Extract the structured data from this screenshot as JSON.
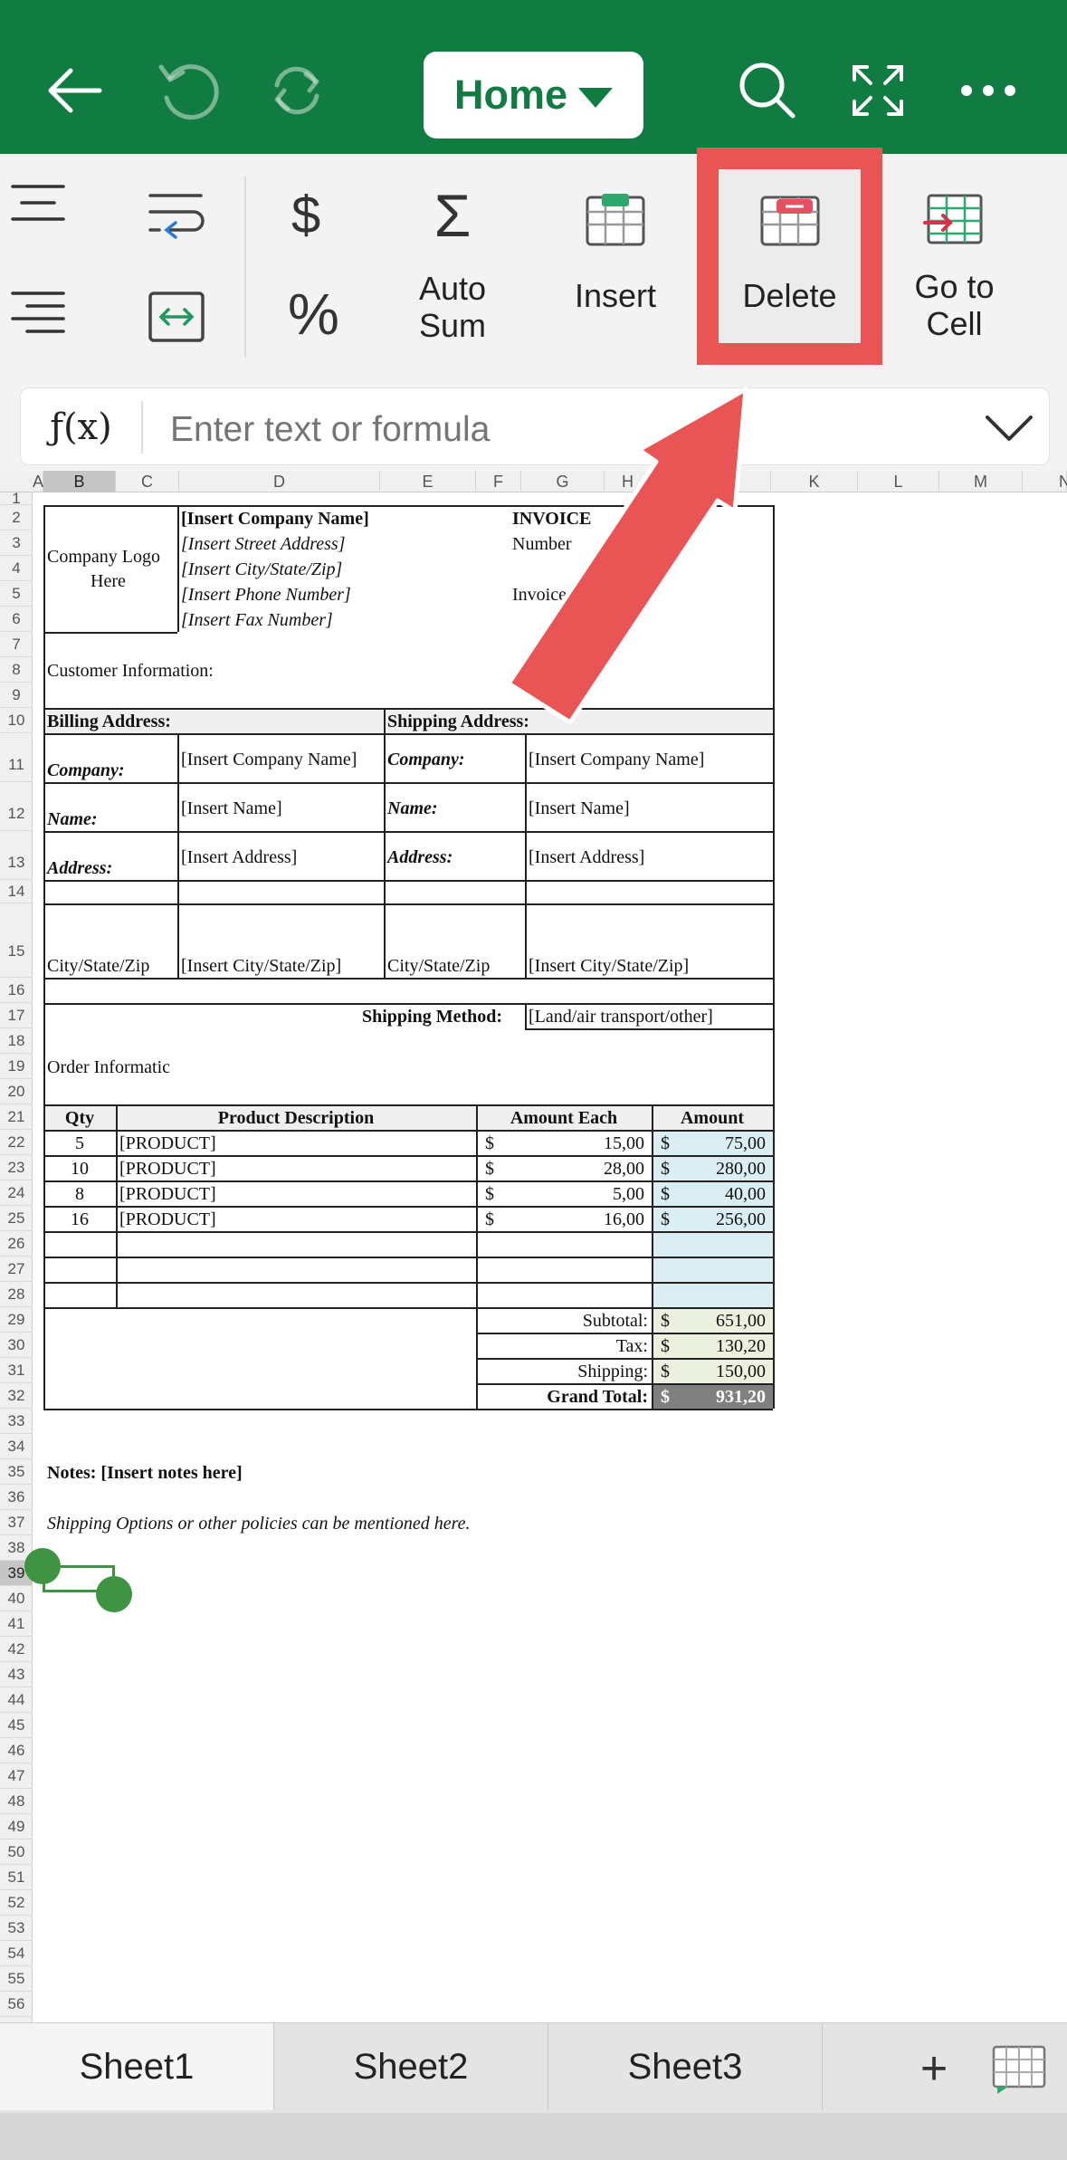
{
  "toolbar": {
    "icons": [
      "back-arrow-icon",
      "undo-icon",
      "redo-icon",
      "search-icon",
      "fullscreen-icon",
      "more-icon"
    ],
    "home_label": "Home"
  },
  "ribbon": {
    "dollar": "$",
    "percent": "%",
    "autosum_label": "Auto\nSum",
    "insert_label": "Insert",
    "delete_label": "Delete",
    "goto_label": "Go to\nCell",
    "accent_color": "#e95454"
  },
  "formula": {
    "fx_label": "ƒ(x)",
    "placeholder": "Enter text or formula"
  },
  "columns": [
    "A",
    "B",
    "C",
    "D",
    "E",
    "F",
    "G",
    "H",
    "I",
    "J",
    "K",
    "L",
    "M",
    "N"
  ],
  "rows": [
    "1",
    "2",
    "3",
    "4",
    "5",
    "6",
    "7",
    "8",
    "9",
    "10",
    "11",
    "12",
    "13",
    "14",
    "15",
    "16",
    "17",
    "18",
    "19",
    "20",
    "21",
    "22",
    "23",
    "24",
    "25",
    "26",
    "27",
    "28",
    "29",
    "30",
    "31",
    "32",
    "33",
    "34",
    "35",
    "36",
    "37",
    "38",
    "39",
    "40",
    "41",
    "42",
    "43",
    "44",
    "45",
    "46",
    "47",
    "48",
    "49",
    "50",
    "51",
    "52",
    "53",
    "54",
    "55",
    "56"
  ],
  "invoice": {
    "logo_line1": "Company Logo",
    "logo_line2": "Here",
    "company_name": "[Insert Company Name]",
    "street": "[Insert Street Address]",
    "city": "[Insert City/State/Zip]",
    "phone": "[Insert Phone Number]",
    "fax": "[Insert Fax Number]",
    "invoice_title": "INVOICE",
    "number_label": "Number",
    "date_label": "Invoice Date:",
    "customer_info": "Customer Information:",
    "billing_address": "Billing Address:",
    "shipping_address": "Shipping Address:",
    "company_label": "Company:",
    "name_label": "Name:",
    "address_label": "Address:",
    "insert_company": "[Insert Company Name]",
    "insert_name": "[Insert Name]",
    "insert_address": "[Insert Address]",
    "city_state_zip": "City/State/Zip",
    "insert_city": "[Insert City/State/Zip]",
    "shipping_method_label": "Shipping Method:",
    "shipping_method_value": "[Land/air transport/other]",
    "order_info": "Order Informatic",
    "headers": {
      "qty": "Qty",
      "desc": "Product Description",
      "each": "Amount Each",
      "amount": "Amount"
    },
    "items": [
      {
        "qty": "5",
        "desc": "[PRODUCT]",
        "each": "15,00",
        "amount": "75,00"
      },
      {
        "qty": "10",
        "desc": "[PRODUCT]",
        "each": "28,00",
        "amount": "280,00"
      },
      {
        "qty": "8",
        "desc": "[PRODUCT]",
        "each": "5,00",
        "amount": "40,00"
      },
      {
        "qty": "16",
        "desc": "[PRODUCT]",
        "each": "16,00",
        "amount": "256,00"
      }
    ],
    "currency": "$",
    "subtotal_label": "Subtotal:",
    "subtotal": "651,00",
    "tax_label": "Tax:",
    "tax": "130,20",
    "shipping_label": "Shipping:",
    "shipping": "150,00",
    "grand_total_label": "Grand Total:",
    "grand_total": "931,20",
    "notes": "Notes: [Insert notes here]",
    "policies": "Shipping Options or other policies can be mentioned here."
  },
  "tabs": {
    "sheet1": "Sheet1",
    "sheet2": "Sheet2",
    "sheet3": "Sheet3",
    "add": "+"
  }
}
